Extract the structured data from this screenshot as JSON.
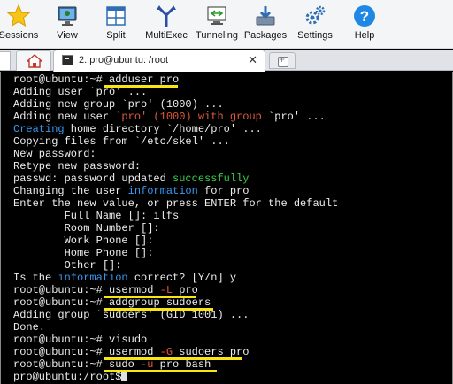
{
  "toolbar": {
    "items": [
      {
        "label": "Sessions",
        "icon": "star-icon"
      },
      {
        "label": "View",
        "icon": "monitor-icon"
      },
      {
        "label": "Split",
        "icon": "split-icon"
      },
      {
        "label": "MultiExec",
        "icon": "multiexec-icon"
      },
      {
        "label": "Tunneling",
        "icon": "tunneling-icon"
      },
      {
        "label": "Packages",
        "icon": "packages-icon"
      },
      {
        "label": "Settings",
        "icon": "gears-icon"
      },
      {
        "label": "Help",
        "icon": "help-icon"
      }
    ]
  },
  "tabs": {
    "session_label": "2. pro@ubuntu: /root",
    "close": "✕"
  },
  "terminal": {
    "prompt": "root@ubuntu:~#",
    "prompt2": "pro@ubuntu:/root$",
    "lines": {
      "l1_cmd": "adduser pro",
      "l2": "Adding user `pro' ...",
      "l3": "Adding new group `pro' (1000) ...",
      "l4a": "Adding new user ",
      "l4b": "`pro' (1000) with group",
      "l4c": " `pro' ...",
      "l5a": "Creating",
      "l5b": " home directory `/home/pro' ...",
      "l6": "Copying files from `/etc/skel' ...",
      "l7": "New password:",
      "l8": "Retype new password:",
      "l9a": "passwd: password updated ",
      "l9b": "successfully",
      "l10a": "Changing the user ",
      "l10b": "information",
      "l10c": " for pro",
      "l11": "Enter the new value, or press ENTER for the default",
      "l12": "        Full Name []: ilfs",
      "l13": "        Room Number []:",
      "l14": "        Work Phone []:",
      "l15": "        Home Phone []:",
      "l16": "        Other []:",
      "l17a": "Is the ",
      "l17b": "information",
      "l17c": " correct? [Y/n] y",
      "l18a": "usermod ",
      "l18b": "-L",
      "l18c": " pro",
      "l19": "addgroup sudoers",
      "l20": "Adding group `sudoers' (GID 1001) ...",
      "l21": "Done.",
      "l22": "visudo",
      "l23a": "usermod ",
      "l23b": "-G",
      "l23c": " sudoers pro",
      "l24a": "sudo ",
      "l24b": "-u",
      "l24c": " pro bash"
    }
  },
  "colors": {
    "highlight": "#f7e614",
    "error_red": "#e05a3a",
    "info_blue": "#3a97ee",
    "success_green": "#3bcf4a"
  }
}
